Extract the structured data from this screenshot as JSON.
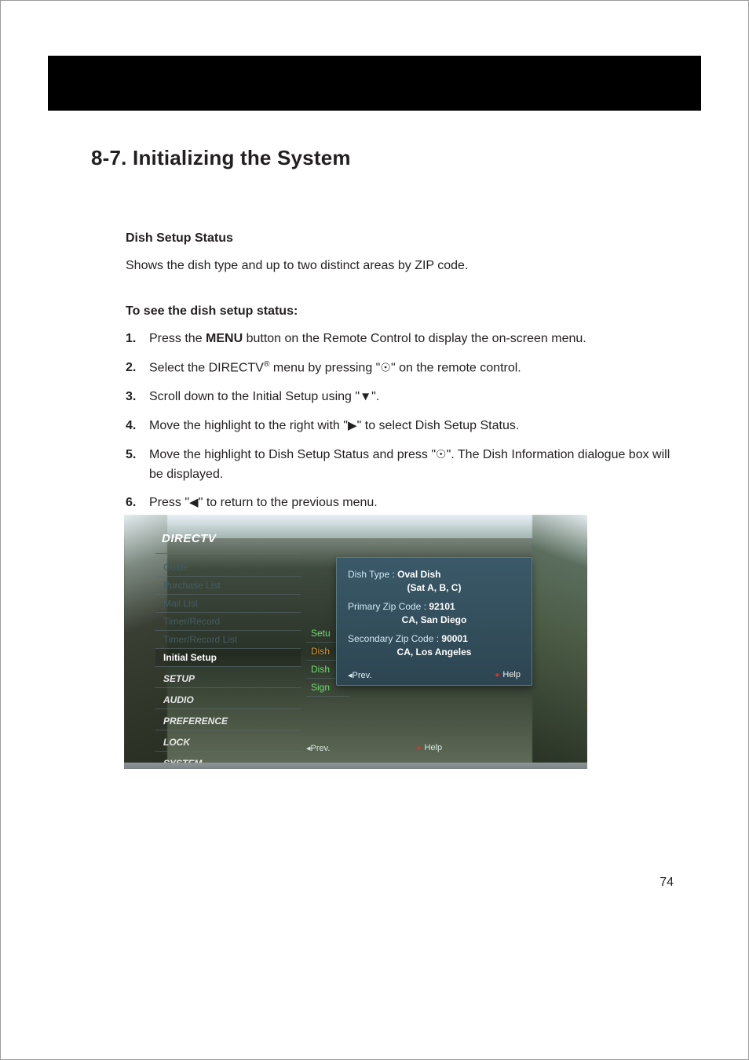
{
  "page_number": "74",
  "heading": "8-7. Initializing the System",
  "section": {
    "title": "Dish Setup Status",
    "description": "Shows the dish type and up to two distinct areas by ZIP code.",
    "steps_title": "To see the dish setup status:"
  },
  "steps": {
    "1": {
      "num": "1.",
      "pre": "Press the ",
      "bold": "MENU",
      "post": " button on the Remote Control to display the on-screen menu."
    },
    "2": {
      "num": "2.",
      "pre": "Select the DIRECTV",
      "sup": "®",
      "mid": " menu by pressing \"",
      "glyph": "☉",
      "post": "\" on the remote control."
    },
    "3": {
      "num": "3.",
      "pre": "Scroll down to the Initial Setup using \"",
      "glyph": "▼",
      "post": "\"."
    },
    "4": {
      "num": "4.",
      "pre": "Move the highlight to the right with \"",
      "glyph": "▶",
      "post": "\" to select Dish Setup Status."
    },
    "5": {
      "num": "5.",
      "pre": "Move the highlight to Dish Setup Status and press \"",
      "glyph": "☉",
      "post": "\". The Dish Information dialogue box will be displayed."
    },
    "6": {
      "num": "6.",
      "pre": "Press \"",
      "glyph": "◀",
      "post": "\" to return to the previous menu."
    }
  },
  "tv": {
    "brand": "DIRECTV",
    "sidebar": {
      "guide": "Guide",
      "purchase": "Purchase List",
      "mail": "Mail List",
      "timer": "Timer/Record",
      "timerlist": "Timer/Record List",
      "initial": "Initial Setup",
      "setup": "SETUP",
      "audio": "AUDIO",
      "preference": "PREFERENCE",
      "lock": "LOCK",
      "system": "SYSTEM"
    },
    "right": {
      "setup": "Setu",
      "dish1": "Dish",
      "dish2": "Dish",
      "sign": "Sign"
    },
    "dialog": {
      "l1a": "Dish Type :  ",
      "l1b": "Oval Dish",
      "l2": "(Sat A, B, C)",
      "l3a": "Primary Zip Code :  ",
      "l3b": "92101",
      "l4": "CA, San Diego",
      "l5a": "Secondary Zip Code : ",
      "l5b": "90001",
      "l6": "CA, Los Angeles",
      "prev": "◂Prev.",
      "help": "Help"
    },
    "bottom": {
      "prev": "◂Prev.",
      "help": "Help"
    }
  }
}
